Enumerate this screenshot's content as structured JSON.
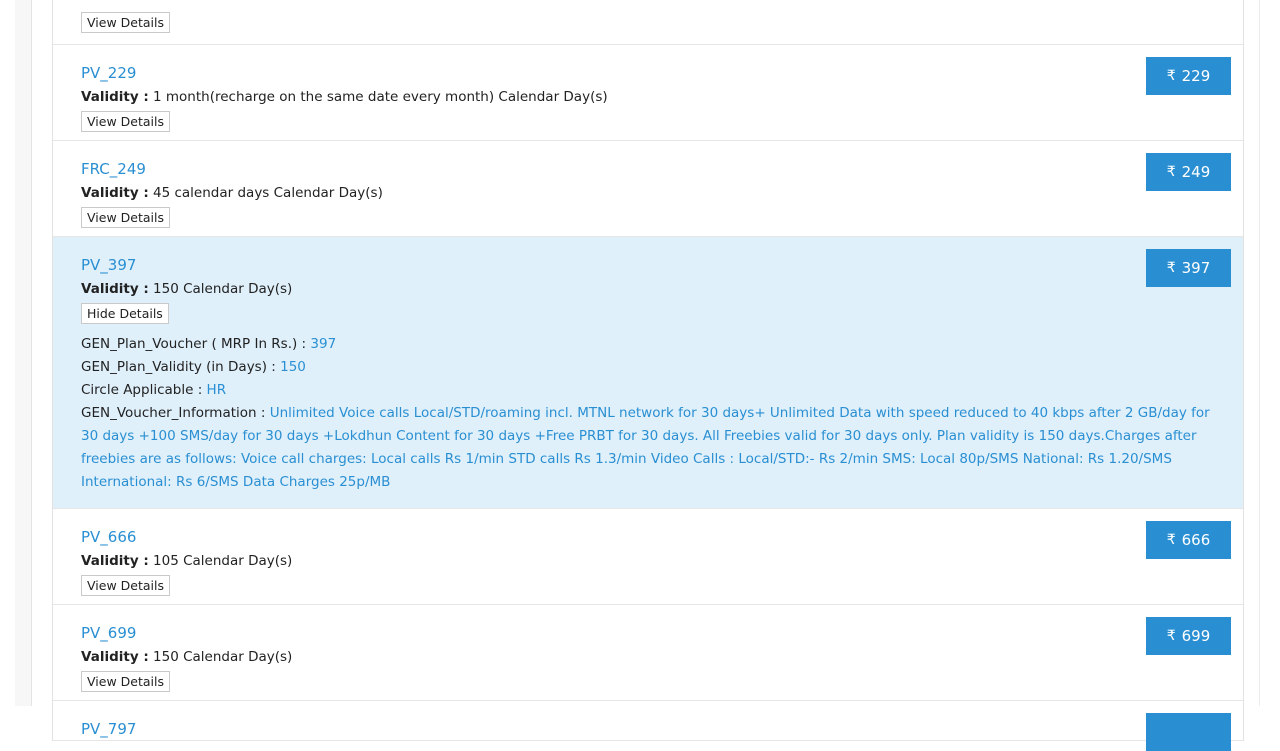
{
  "plans": [
    {
      "name": "",
      "validity_label": "",
      "validity_value": "",
      "details_button": "View Details",
      "price": ""
    },
    {
      "name": "PV_229",
      "validity_label": "Validity :",
      "validity_value": "1 month(recharge on the same date every month) Calendar Day(s)",
      "details_button": "View Details",
      "price": "229"
    },
    {
      "name": "FRC_249",
      "validity_label": "Validity :",
      "validity_value": "45 calendar days Calendar Day(s)",
      "details_button": "View Details",
      "price": "249"
    },
    {
      "name": "PV_397",
      "validity_label": "Validity :",
      "validity_value": "150 Calendar Day(s)",
      "details_button": "Hide Details",
      "price": "397",
      "details": {
        "voucher_label": "GEN_Plan_Voucher ( MRP In Rs.) :",
        "voucher_value": "397",
        "validity_days_label": "GEN_Plan_Validity (in Days) :",
        "validity_days_value": "150",
        "circle_label": "Circle Applicable :",
        "circle_value": "HR",
        "info_label": "GEN_Voucher_Information :",
        "info_value": "Unlimited Voice calls Local/STD/roaming incl. MTNL network for 30 days+ Unlimited Data with speed reduced to 40 kbps after 2 GB/day for 30 days +100 SMS/day for 30 days +Lokdhun Content for 30 days +Free PRBT for 30 days. All Freebies valid for 30 days only. Plan validity is 150 days.Charges after freebies are as follows: Voice call charges: Local calls Rs 1/min STD calls Rs 1.3/min Video Calls : Local/STD:- Rs 2/min SMS: Local 80p/SMS National: Rs 1.20/SMS International: Rs 6/SMS Data Charges 25p/MB"
      }
    },
    {
      "name": "PV_666",
      "validity_label": "Validity :",
      "validity_value": "105 Calendar Day(s)",
      "details_button": "View Details",
      "price": "666"
    },
    {
      "name": "PV_699",
      "validity_label": "Validity :",
      "validity_value": "150 Calendar Day(s)",
      "details_button": "View Details",
      "price": "699"
    },
    {
      "name": "PV_797",
      "price": ""
    }
  ],
  "currency_symbol": "₹",
  "colors": {
    "accent": "#2a8fd2",
    "expanded_bg": "#dff0fb"
  }
}
